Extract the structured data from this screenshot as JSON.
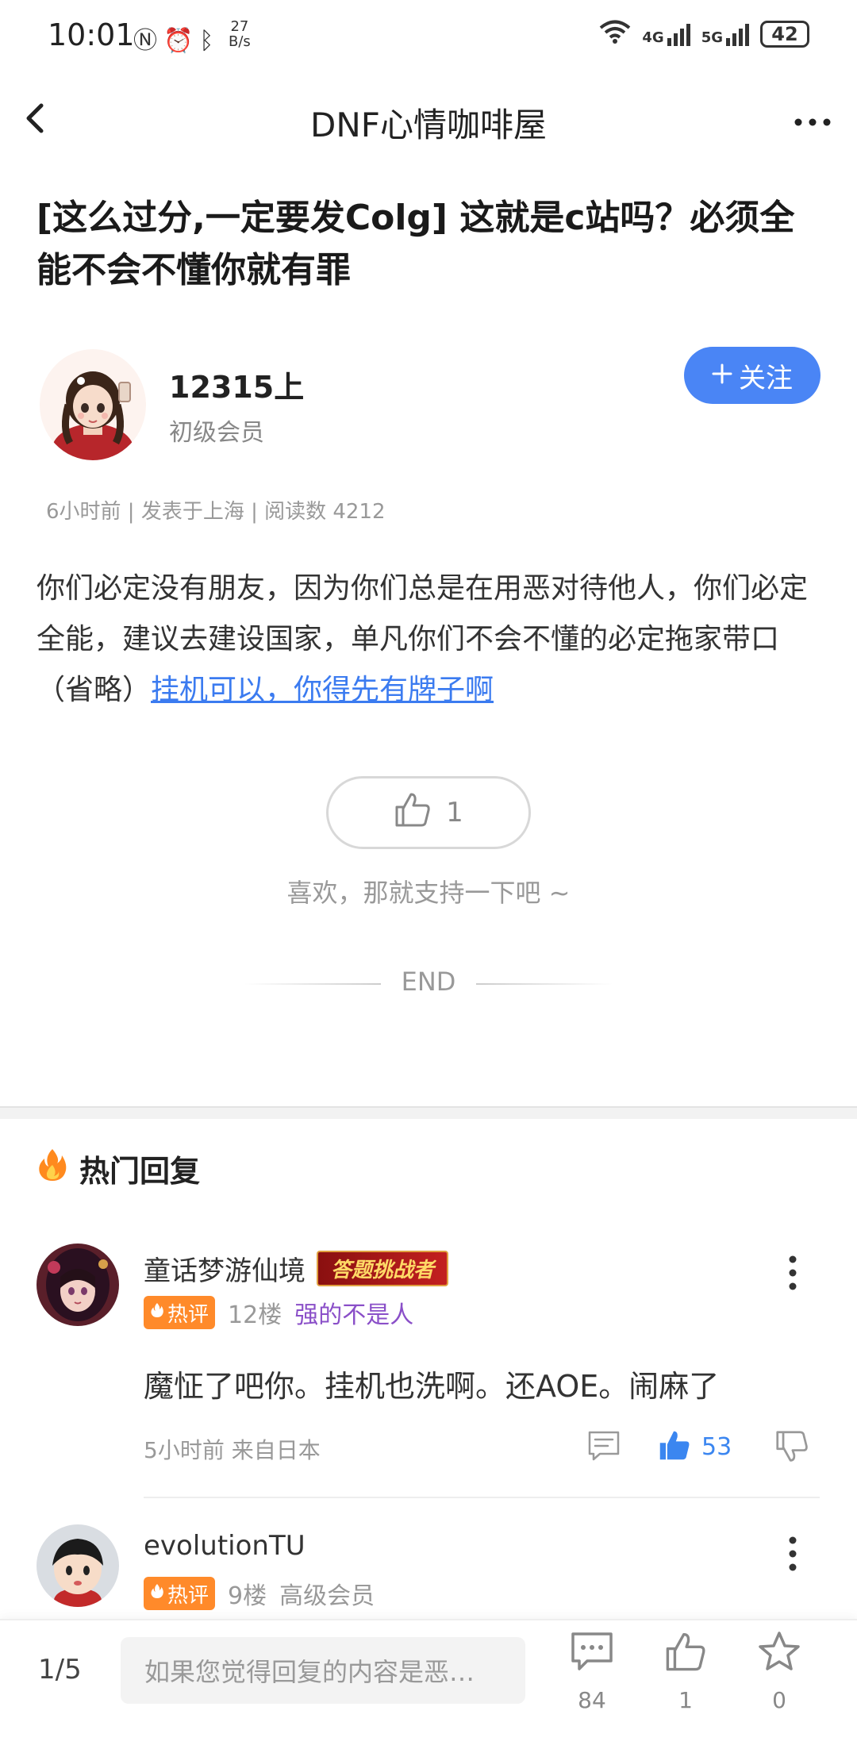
{
  "status": {
    "time": "10:01",
    "net_speed_top": "27",
    "net_speed_bottom": "B/s",
    "net1": "4G",
    "net2": "5G",
    "battery": "42"
  },
  "nav": {
    "back_icon": "chevron-left-icon",
    "title": "DNF心情咖啡屋",
    "more_icon": "more-horizontal-icon"
  },
  "post": {
    "title": "[这么过分,一定要发Colg] 这就是c站吗？必须全能不会不懂你就有罪",
    "author": {
      "name": "12315上",
      "level": "初级会员",
      "follow_label": "关注",
      "follow_icon": "plus-icon"
    },
    "meta": "6小时前 | 发表于上海 | 阅读数 4212",
    "body_text": "你们必定没有朋友，因为你们总是在用恶对待他人，你们必定全能，建议去建设国家，单凡你们不会不懂的必定拖家带口（省略）",
    "body_link": "挂机可以，你得先有牌子啊",
    "like_count": "1",
    "like_hint": "喜欢，那就支持一下吧 ~",
    "end_label": "END"
  },
  "hot_replies": {
    "heading": "热门回复",
    "items": [
      {
        "name": "童话梦游仙境",
        "badge": "答题挑战者",
        "hot_tag": "热评",
        "floor": "12楼",
        "subtitle": "强的不是人",
        "subtitle_color": "#8a4fc8",
        "text": "魔怔了吧你。挂机也洗啊。还AOE。闹麻了",
        "time_location": "5小时前 来自日本",
        "likes": "53"
      },
      {
        "name": "evolutionTU",
        "hot_tag": "热评",
        "floor": "9楼",
        "subtitle": "高级会员",
        "subtitle_color": "#999999"
      }
    ]
  },
  "bottom_bar": {
    "page_indicator": "1/5",
    "input_placeholder": "如果您觉得回复的内容是恶…",
    "comments_count": "84",
    "likes_count": "1",
    "favorites_count": "0"
  },
  "colors": {
    "accent": "#4a85f5",
    "link": "#3b7bf0",
    "hot_tag": "#ff8a2a"
  }
}
